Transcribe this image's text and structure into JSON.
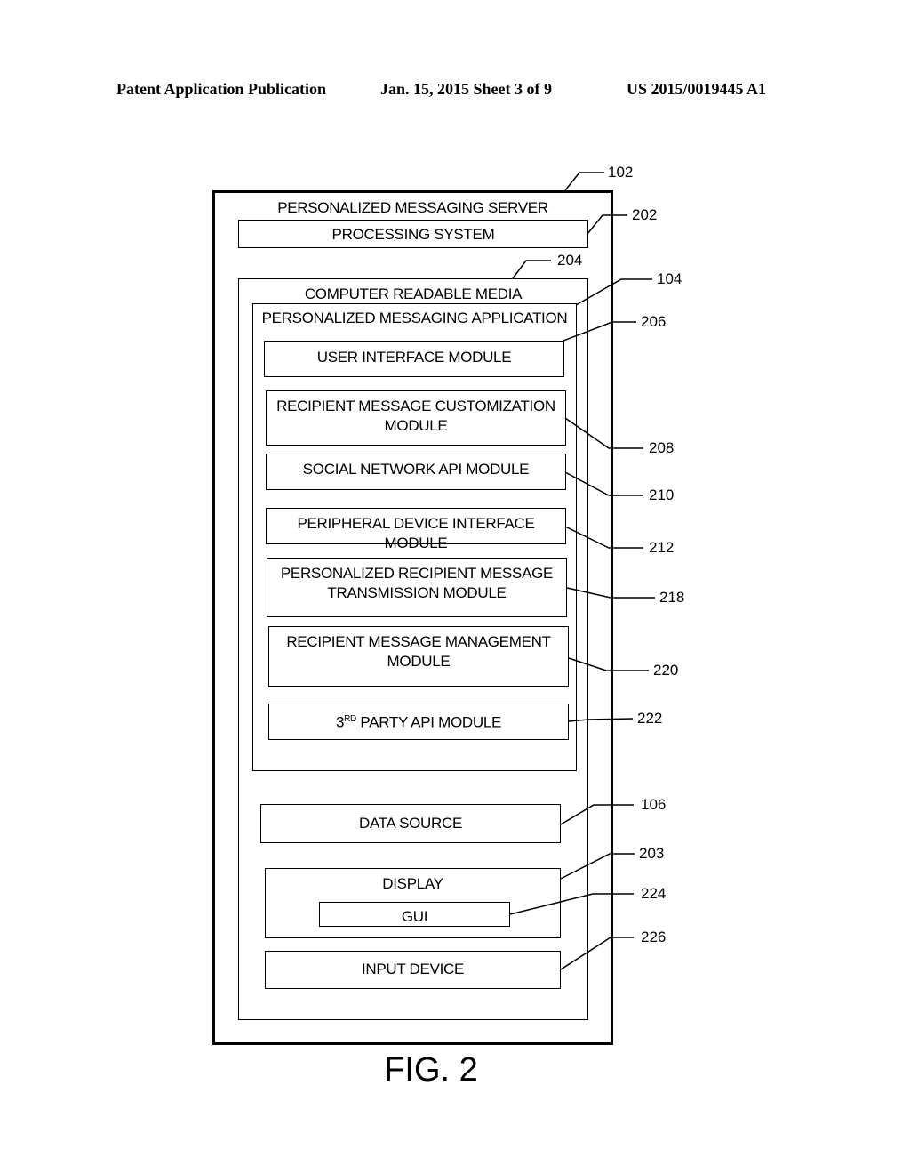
{
  "header": {
    "publication": "Patent Application Publication",
    "date_sheet": "Jan. 15, 2015  Sheet 3 of 9",
    "number": "US 2015/0019445 A1"
  },
  "diagram": {
    "server": {
      "label": "PERSONALIZED MESSAGING SERVER",
      "ref": "102"
    },
    "processing": {
      "label": "PROCESSING SYSTEM",
      "ref": "202"
    },
    "crm": {
      "label": "COMPUTER READABLE MEDIA",
      "ref": "204"
    },
    "app": {
      "label": "PERSONALIZED MESSAGING APPLICATION",
      "ref": "104"
    },
    "modules": [
      {
        "line1": "USER INTERFACE MODULE",
        "line2": "",
        "ref": "206"
      },
      {
        "line1": "RECIPIENT MESSAGE CUSTOMIZATION",
        "line2": "MODULE",
        "ref": "208"
      },
      {
        "line1": "SOCIAL NETWORK API MODULE",
        "line2": "",
        "ref": "210"
      },
      {
        "line1": "PERIPHERAL DEVICE INTERFACE MODULE",
        "line2": "",
        "ref": "212"
      },
      {
        "line1": "PERSONALIZED RECIPIENT MESSAGE",
        "line2": "TRANSMISSION MODULE",
        "ref": "218"
      },
      {
        "line1": "RECIPIENT MESSAGE MANAGEMENT",
        "line2": "MODULE",
        "ref": "220"
      },
      {
        "line1_prefix": "3",
        "line1_sup": "RD",
        "line1": "PARTY API  MODULE",
        "line2": "",
        "ref": "222"
      }
    ],
    "data_source": {
      "label": "DATA SOURCE",
      "ref": "106"
    },
    "display": {
      "label": "DISPLAY",
      "ref": "203"
    },
    "gui": {
      "label": "GUI",
      "ref": "224"
    },
    "input_device": {
      "label": "INPUT DEVICE",
      "ref": "226"
    }
  },
  "figure_label": "FIG. 2"
}
